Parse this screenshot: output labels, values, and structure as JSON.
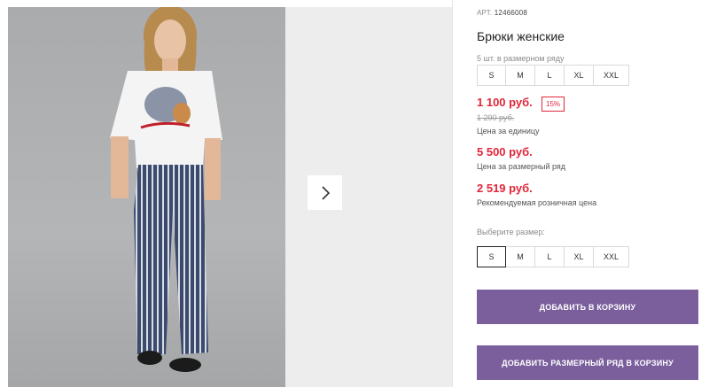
{
  "gallery": {
    "next_icon": "chevron-right-icon"
  },
  "product": {
    "article_label": "АРТ.",
    "article_number": "12466008",
    "title": "Брюки женские",
    "pack_label": "5 шт. в размерном ряду",
    "pack_sizes": [
      "S",
      "M",
      "L",
      "XL",
      "XXL"
    ],
    "price_unit": "1 100 руб.",
    "discount_badge": "15%",
    "old_price": "1 290 руб.",
    "price_unit_caption": "Цена за единицу",
    "price_pack": "5 500 руб.",
    "price_pack_caption": "Цена за размерный ряд",
    "price_retail": "2 519 руб.",
    "price_retail_caption": "Рекомендуемая розничная цена",
    "choose_size_label": "Выберите размер:",
    "sizes": [
      "S",
      "M",
      "L",
      "XL",
      "XXL"
    ],
    "selected_size": "S",
    "add_to_cart_label": "ДОБАВИТЬ В КОРЗИНУ",
    "add_pack_to_cart_label": "ДОБАВИТЬ РАЗМЕРНЫЙ РЯД В КОРЗИНУ"
  },
  "colors": {
    "accent": "#7a5f9c",
    "price_red": "#e0263a"
  }
}
